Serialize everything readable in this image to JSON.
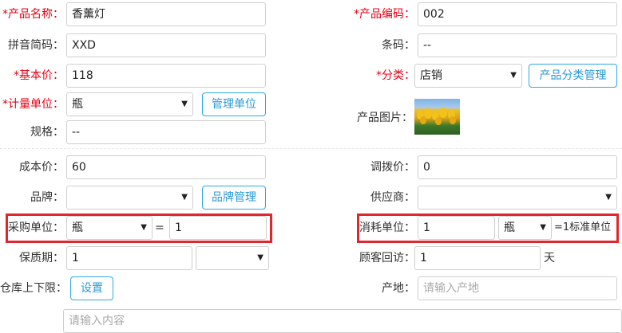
{
  "left": {
    "product_name": {
      "required": "*",
      "label": "产品名称：",
      "value": "香薰灯"
    },
    "pinyin_code": {
      "label": "拼音简码：",
      "value": "XXD"
    },
    "base_price": {
      "required": "*",
      "label": "基本价：",
      "value": "118"
    },
    "unit": {
      "required": "*",
      "label": "计量单位：",
      "value": "瓶",
      "button": "管理单位"
    },
    "spec": {
      "label": "规格：",
      "value": "--"
    },
    "cost_price": {
      "label": "成本价：",
      "value": "60"
    },
    "brand": {
      "label": "品牌：",
      "value": "",
      "button": "品牌管理"
    },
    "purchase_unit": {
      "label": "采购单位：",
      "value": "瓶",
      "equals": "=",
      "qty": "1"
    },
    "shelf_life": {
      "label": "保质期：",
      "value": "1",
      "unit_value": ""
    },
    "stock_limit": {
      "label": "仓库上下限：",
      "button": "设置"
    },
    "content": {
      "placeholder": "请输入内容"
    }
  },
  "right": {
    "product_code": {
      "required": "*",
      "label": "产品编码：",
      "value": "002"
    },
    "barcode": {
      "label": "条码：",
      "value": "--"
    },
    "category": {
      "required": "*",
      "label": "分类：",
      "value": "店销",
      "button": "产品分类管理"
    },
    "product_image": {
      "label": "产品图片："
    },
    "transfer_price": {
      "label": "调拨价：",
      "value": "0"
    },
    "supplier": {
      "label": "供应商：",
      "value": ""
    },
    "consume_unit": {
      "label": "消耗单位：",
      "qty": "1",
      "value": "瓶",
      "suffix": "=1标准单位"
    },
    "revisit": {
      "label": "顾客回访：",
      "value": "1",
      "suffix": "天"
    },
    "origin": {
      "label": "产地：",
      "placeholder": "请输入产地"
    }
  },
  "colors": {
    "required": "#e60012",
    "button": "#2a9ad6",
    "highlight_box": "#e0262e"
  },
  "icons": {
    "dropdown": "caret-down-icon"
  }
}
